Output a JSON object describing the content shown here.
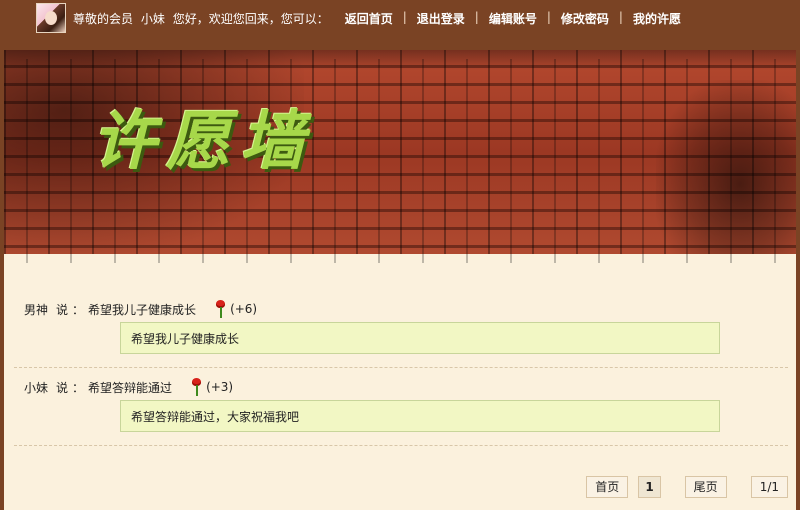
{
  "header": {
    "greeting_parts": [
      "尊敬的会员",
      "小妹",
      "您好，欢迎您回来，您可以："
    ],
    "nav": [
      {
        "label": "返回首页"
      },
      {
        "label": "退出登录"
      },
      {
        "label": "编辑账号"
      },
      {
        "label": "修改密码"
      },
      {
        "label": "我的许愿"
      }
    ]
  },
  "banner": {
    "title": "许愿墙"
  },
  "wishes": [
    {
      "author": "男神",
      "say": "说",
      "colon": "：",
      "title": "希望我儿子健康成长",
      "votes": "(+6)",
      "content": "希望我儿子健康成长"
    },
    {
      "author": "小妹",
      "say": "说",
      "colon": "：",
      "title": "希望答辩能通过",
      "votes": "(+3)",
      "content": "希望答辩能通过，大家祝福我吧"
    }
  ],
  "pager": {
    "first": "首页",
    "current": "1",
    "last": "尾页",
    "info": "1/1"
  }
}
